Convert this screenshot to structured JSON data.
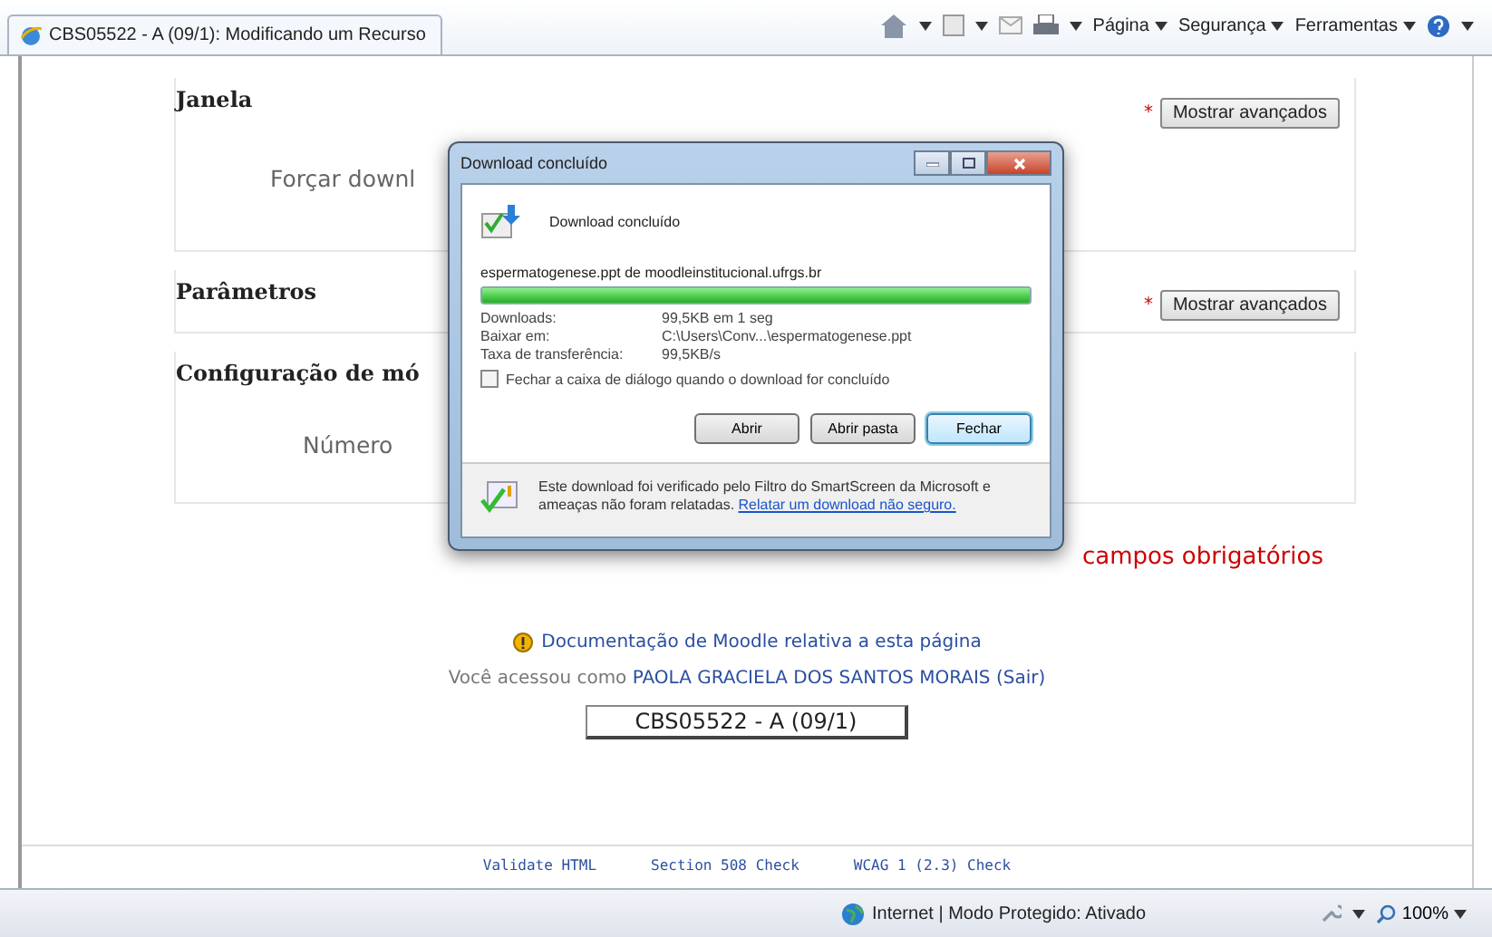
{
  "browser": {
    "tab_title": "CBS05522 - A (09/1): Modificando um Recurso",
    "menus": [
      "Página",
      "Segurança",
      "Ferramentas"
    ]
  },
  "page": {
    "sections": [
      {
        "legend": "Janela",
        "label": "Forçar downl",
        "required_mark": "*",
        "button": "Mostrar avançados"
      },
      {
        "legend": "Parâmetros",
        "required_mark": "*",
        "button": "Mostrar avançados"
      },
      {
        "legend": "Configuração de mó",
        "label": "Número"
      }
    ],
    "required_note": "campos obrigatórios",
    "doc_link": "Documentação de Moodle relativa a esta página",
    "login": {
      "prefix": "Você acessou como",
      "user": "PAOLA GRACIELA DOS SANTOS MORAIS",
      "logout": "(Sair)"
    },
    "course_button": "CBS05522 - A (09/1)",
    "footer_links": [
      "Validate HTML",
      "Section 508 Check",
      "WCAG 1 (2.3) Check"
    ]
  },
  "dialog": {
    "title": "Download concluído",
    "heading": "Download concluído",
    "source": "espermatogenese.ppt de moodleinstitucional.ufrgs.br",
    "progress": {
      "level": 1
    },
    "details": [
      {
        "label": "Downloads:",
        "value": "99,5KB em 1 seg"
      },
      {
        "label": "Baixar em:",
        "value": "C:\\Users\\Conv...\\espermatogenese.ppt"
      },
      {
        "label": "Taxa de transferência:",
        "value": "99,5KB/s"
      }
    ],
    "close_when_done": {
      "label": "Fechar a caixa de diálogo quando o download for concluído",
      "checked": false
    },
    "buttons": [
      {
        "label": "Abrir",
        "default": false
      },
      {
        "label": "Abrir pasta",
        "default": false
      },
      {
        "label": "Fechar",
        "default": true
      }
    ],
    "notice": {
      "text": "Este download foi verificado pelo Filtro do SmartScreen da Microsoft e ameaças não foram relatadas.",
      "link": "Relatar um download não seguro."
    }
  },
  "status_bar": {
    "zone": "Internet | Modo Protegido: Ativado",
    "zoom": "100%"
  }
}
